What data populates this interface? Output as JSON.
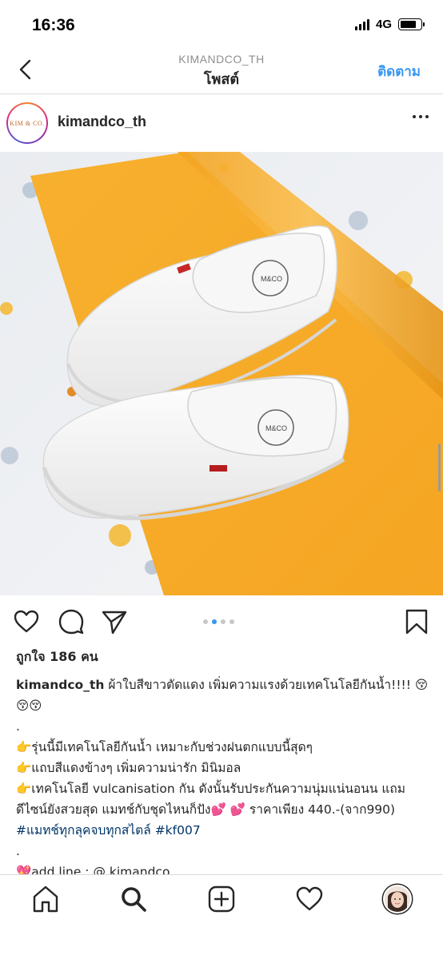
{
  "status_bar": {
    "time": "16:36",
    "network": "4G"
  },
  "header": {
    "subtitle": "KIMANDCO_TH",
    "title": "โพสต์",
    "follow_label": "ติดตาม"
  },
  "post": {
    "username": "kimandco_th",
    "avatar_logo_text": "KIM & CO.",
    "image_description_icon": "white-slip-on-shoes-photo",
    "carousel": {
      "count": 4,
      "active_index": 1
    },
    "likes": "ถูกใจ 186 คน",
    "caption": {
      "user": "kimandco_th",
      "line1": "ผ้าใบสีขาวตัดแดง เพิ่มความแรงด้วยเทคโนโลยีกันน้ำ!!!! 😚😚😚",
      "dot1": ".",
      "line2": "👉รุ่นนี้มีเทคโนโลยีกันน้ำ เหมาะกับช่วงฝนตกแบบนี้สุดๆ",
      "line3": "👉แถบสีแดงข้างๆ เพิ่มความน่ารัก มินิมอล",
      "line4": "👉เทคโนโลยี vulcanisation กัน ดังนั้นรับประกันความนุ่มแน่นอนน แถมดีไซน์ยังสวยสุด แมทช์กับชุดไหนก็ปัง💕 💕 ราคาเพียง 440.-(จาก990) ",
      "hashtag1": "#แมทช์ทุกลุคจบทุกสไตล์",
      "hashtag2": "#kf007",
      "dot2": ".",
      "line5": "💖add line : @ kimandco"
    }
  },
  "colors": {
    "accent": "#3897f0",
    "text": "#262626",
    "hashtag": "#003569",
    "paper_orange": "#f8ad2a"
  },
  "icons": {
    "back": "chevron-left-icon",
    "more": "more-horizontal-icon",
    "like": "heart-icon",
    "comment": "comment-icon",
    "share": "send-icon",
    "save": "bookmark-icon",
    "home": "home-icon",
    "search": "search-icon",
    "new_post": "plus-square-icon",
    "activity": "heart-icon",
    "profile": "profile-avatar"
  }
}
